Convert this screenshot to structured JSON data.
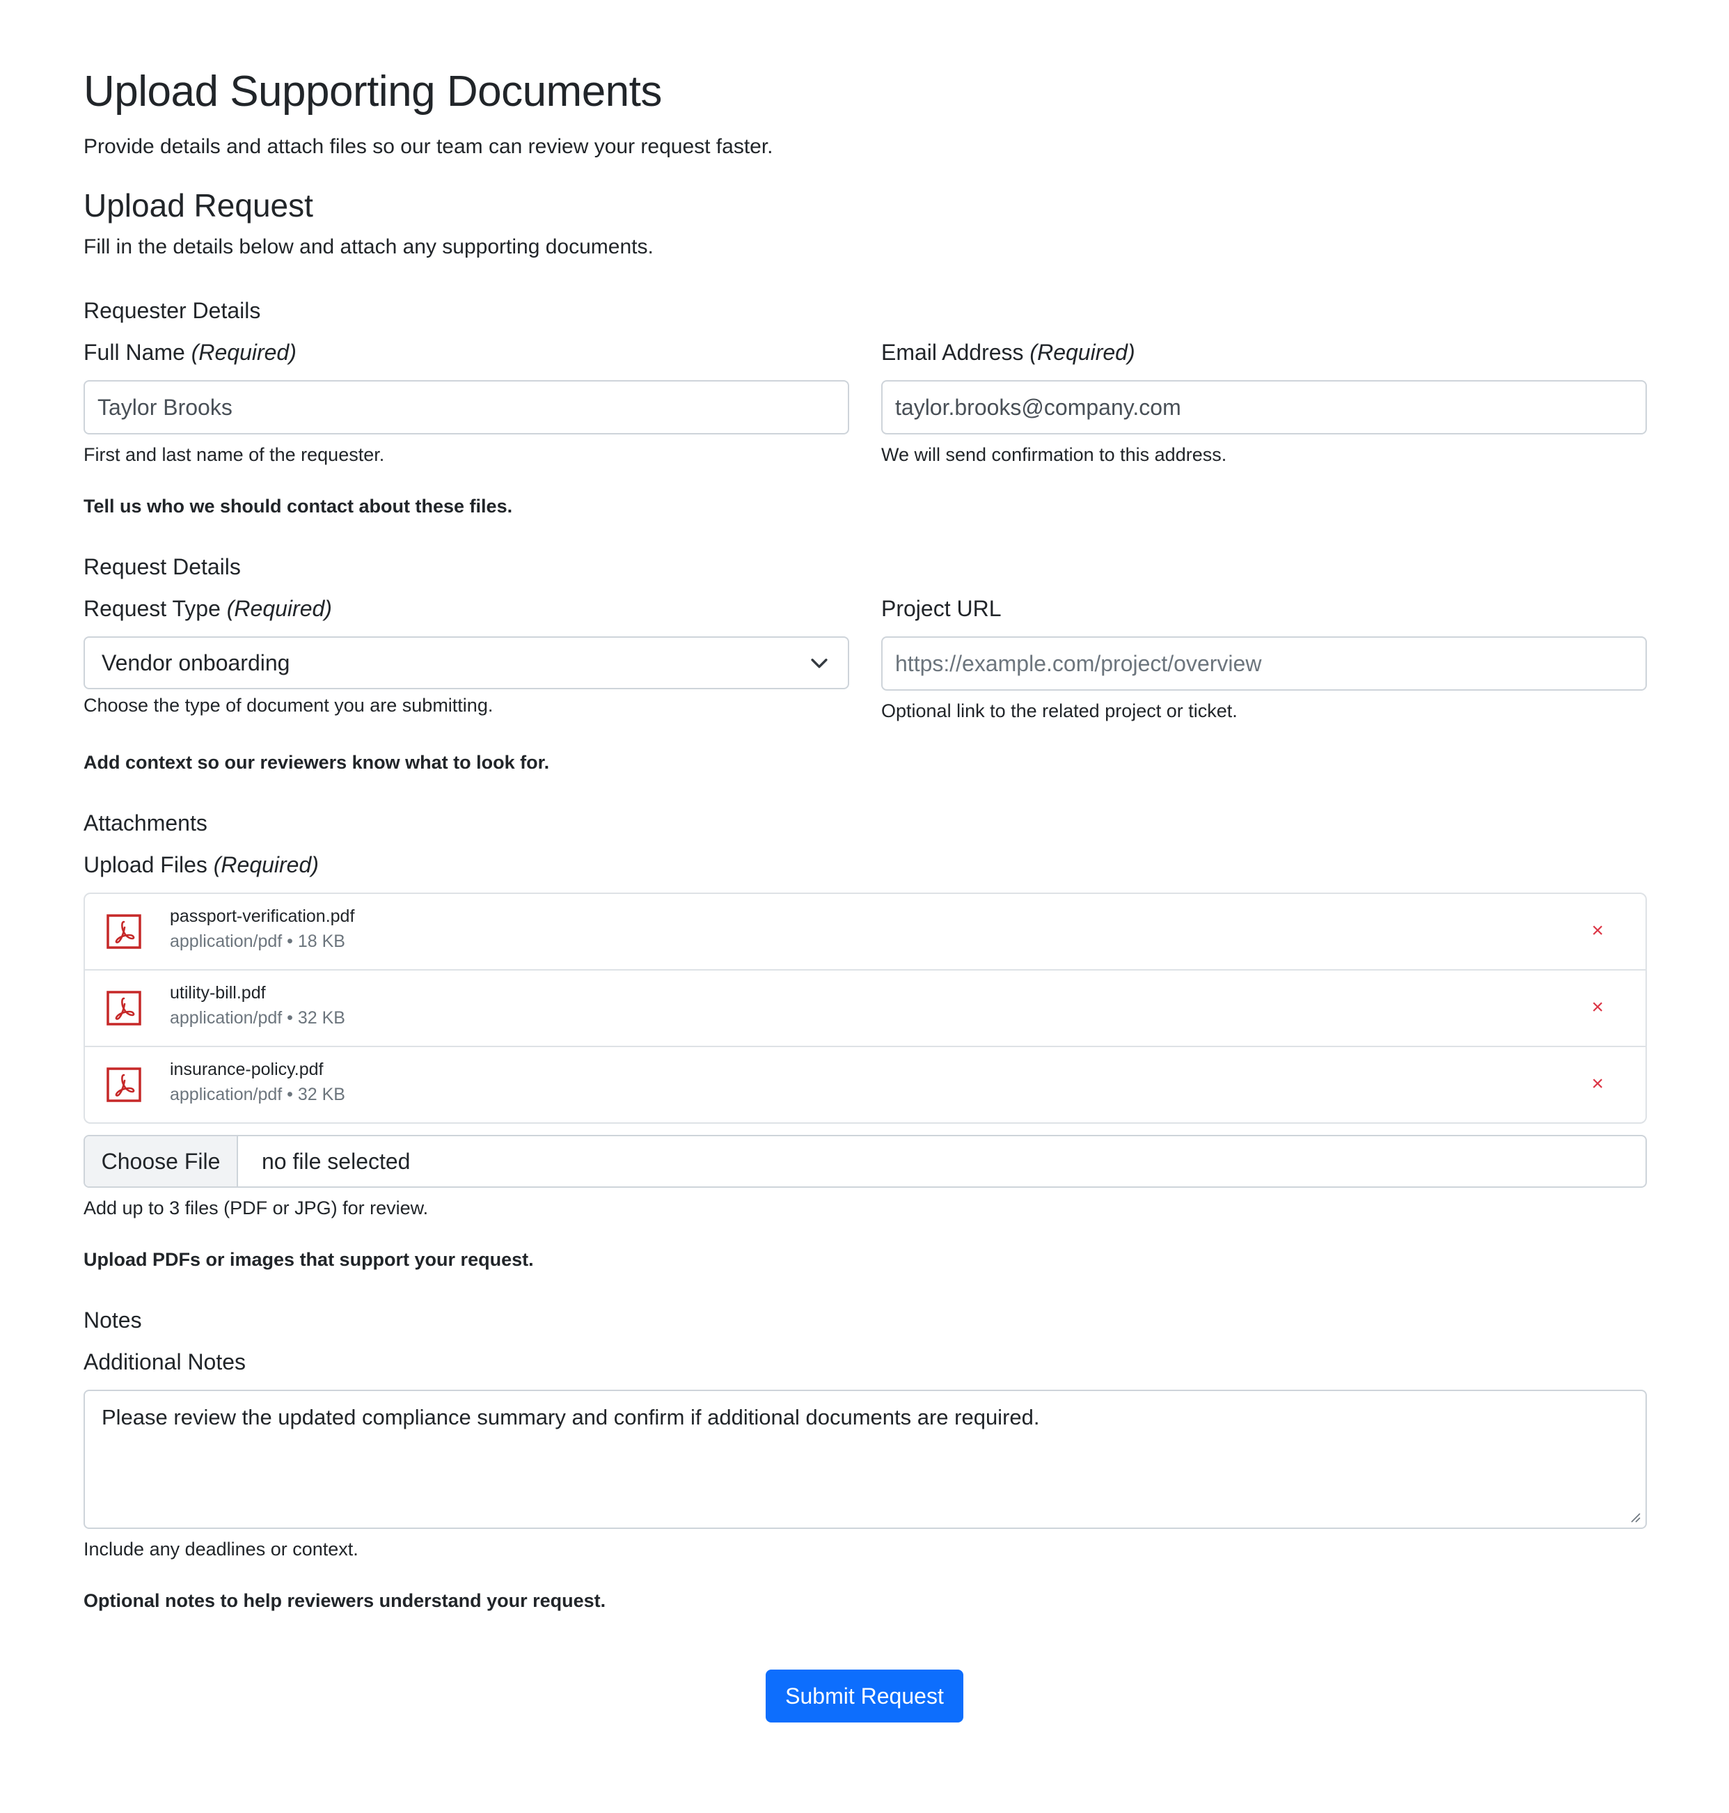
{
  "page": {
    "title": "Upload Supporting Documents",
    "subtitle": "Provide details and attach files so our team can review your request faster."
  },
  "form": {
    "title": "Upload Request",
    "description": "Fill in the details below and attach any supporting documents."
  },
  "requester": {
    "section_title": "Requester Details",
    "full_name": {
      "label": "Full Name",
      "required_text": "(Required)",
      "value": "Taylor Brooks",
      "help": "First and last name of the requester."
    },
    "email": {
      "label": "Email Address",
      "required_text": "(Required)",
      "value": "taylor.brooks@company.com",
      "help": "We will send confirmation to this address."
    },
    "note": "Tell us who we should contact about these files."
  },
  "request": {
    "section_title": "Request Details",
    "type": {
      "label": "Request Type",
      "required_text": "(Required)",
      "selected": "Vendor onboarding",
      "help": "Choose the type of document you are submitting."
    },
    "project_url": {
      "label": "Project URL",
      "placeholder": "https://example.com/project/overview",
      "help": "Optional link to the related project or ticket."
    },
    "note": "Add context so our reviewers know what to look for."
  },
  "attachments": {
    "section_title": "Attachments",
    "label": "Upload Files",
    "required_text": "(Required)",
    "files": [
      {
        "name": "passport-verification.pdf",
        "type": "application/pdf",
        "size": "18 KB",
        "meta": "application/pdf • 18 KB"
      },
      {
        "name": "utility-bill.pdf",
        "type": "application/pdf",
        "size": "32 KB",
        "meta": "application/pdf • 32 KB"
      },
      {
        "name": "insurance-policy.pdf",
        "type": "application/pdf",
        "size": "32 KB",
        "meta": "application/pdf • 32 KB"
      }
    ],
    "remove_icon": "×",
    "file_icon": "pdf-icon",
    "choose_file_label": "Choose File",
    "no_file_text": "no file selected",
    "help": "Add up to 3 files (PDF or JPG) for review.",
    "note": "Upload PDFs or images that support your request."
  },
  "notes": {
    "section_title": "Notes",
    "label": "Additional Notes",
    "value": "Please review the updated compliance summary and confirm if additional documents are required.",
    "help": "Include any deadlines or context.",
    "note": "Optional notes to help reviewers understand your request."
  },
  "submit_label": "Submit Request",
  "colors": {
    "primary": "#0d6efd",
    "danger": "#dc3545",
    "pdf_red": "#c62828",
    "border": "#ced4da",
    "muted": "#6c757d"
  }
}
